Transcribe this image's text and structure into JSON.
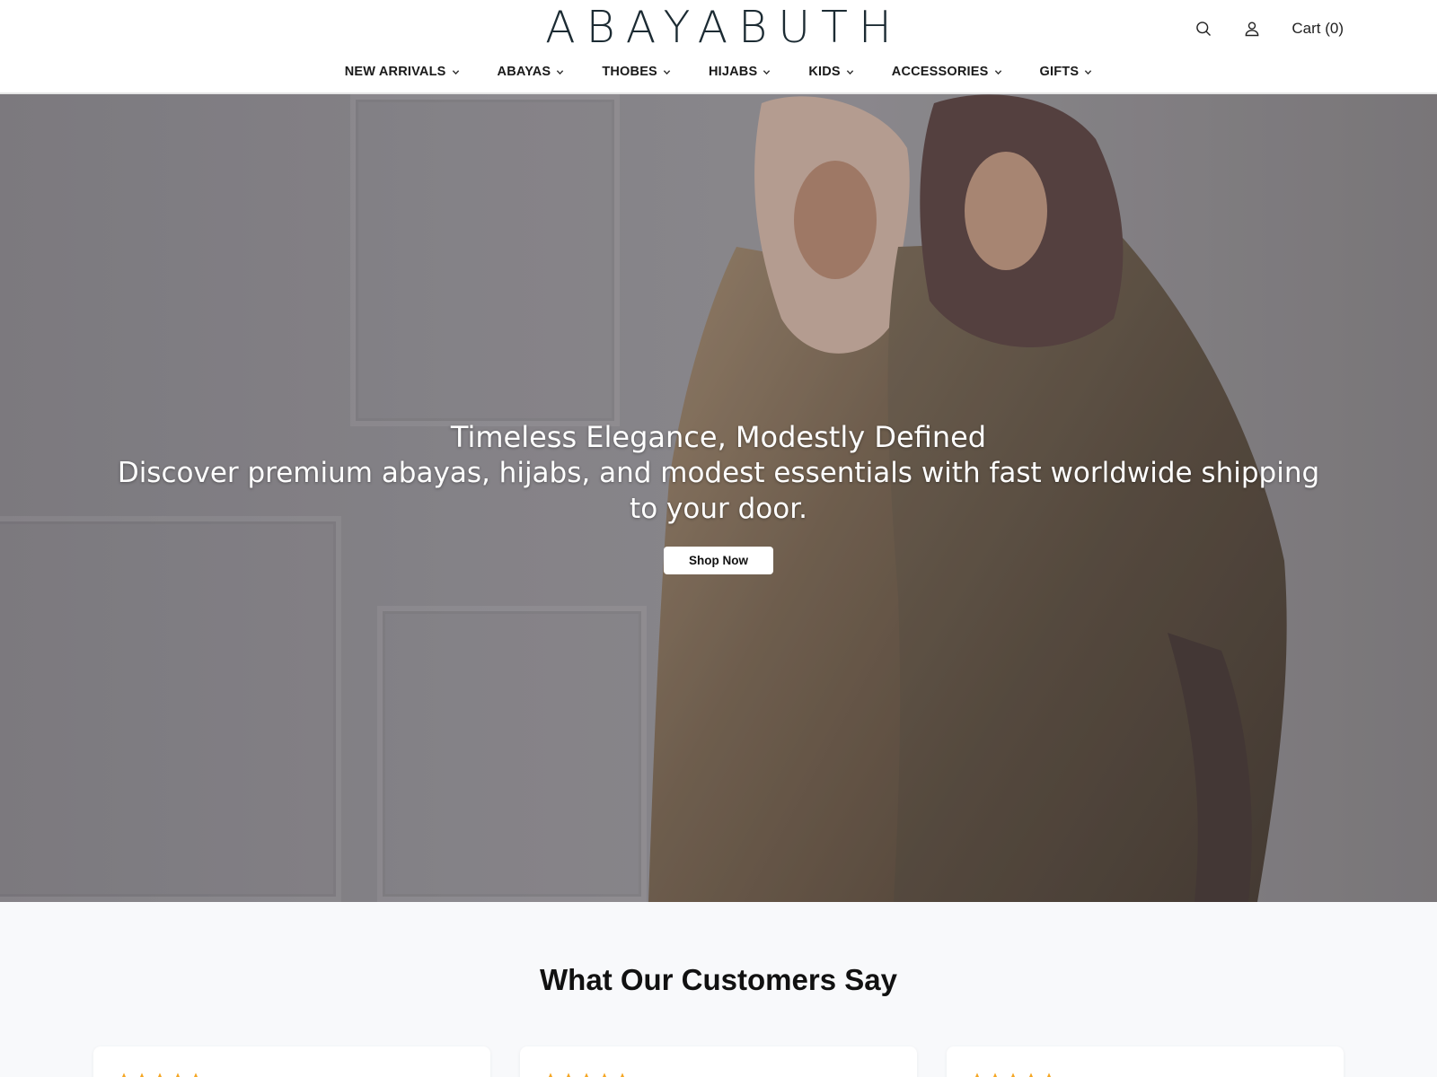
{
  "header": {
    "logo_text": "ABAYABUTH",
    "cart_label": "Cart (0)",
    "icons": {
      "search": "search-icon",
      "account": "user-icon"
    }
  },
  "nav": {
    "items": [
      {
        "label": "NEW ARRIVALS"
      },
      {
        "label": "ABAYAS"
      },
      {
        "label": "THOBES"
      },
      {
        "label": "HIJABS"
      },
      {
        "label": "KIDS"
      },
      {
        "label": "ACCESSORIES"
      },
      {
        "label": "GIFTS"
      }
    ]
  },
  "hero": {
    "title": "Timeless Elegance, Modestly Defined",
    "subtitle": "Discover premium abayas, hijabs, and modest essentials with fast worldwide shipping to your door.",
    "cta_label": "Shop Now"
  },
  "reviews": {
    "title": "What Our Customers Say",
    "cards": [
      {
        "rating": 5
      },
      {
        "rating": 5
      },
      {
        "rating": 5
      }
    ]
  },
  "colors": {
    "logo": "#1c2b33",
    "star": "#f5a623",
    "reviews_bg": "#f8f9fb"
  }
}
